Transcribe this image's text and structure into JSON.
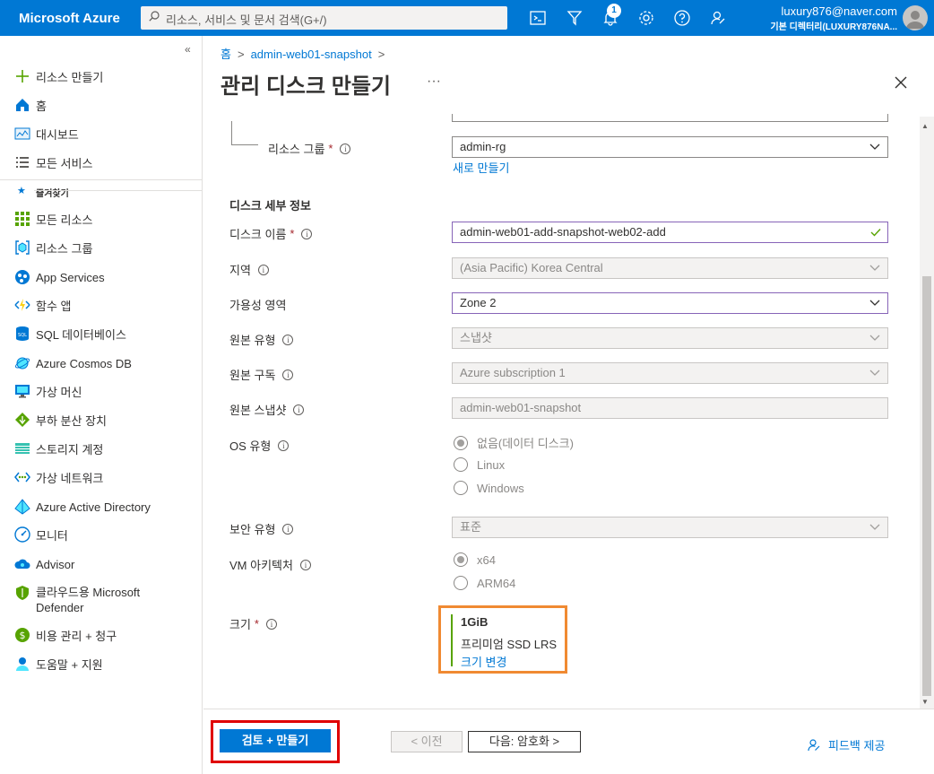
{
  "topbar": {
    "brand": "Microsoft Azure",
    "search_placeholder": "리소스, 서비스 및 문서 검색(G+/)",
    "notification_count": "1",
    "account_email": "luxury876@naver.com",
    "account_directory": "기본 디렉터리(LUXURY876NA..."
  },
  "sidebar": {
    "collapse": "«",
    "favorites_label": "즐겨찾기",
    "items": [
      {
        "label": "리소스 만들기",
        "icon": "plus-icon"
      },
      {
        "label": "홈",
        "icon": "home-icon"
      },
      {
        "label": "대시보드",
        "icon": "dashboard-icon"
      },
      {
        "label": "모든 서비스",
        "icon": "list-icon"
      },
      {
        "label": "모든 리소스",
        "icon": "grid-icon"
      },
      {
        "label": "리소스 그룹",
        "icon": "resource-group-icon"
      },
      {
        "label": "App Services",
        "icon": "app-services-icon"
      },
      {
        "label": "함수 앱",
        "icon": "function-app-icon"
      },
      {
        "label": "SQL 데이터베이스",
        "icon": "sql-icon"
      },
      {
        "label": "Azure Cosmos DB",
        "icon": "cosmos-icon"
      },
      {
        "label": "가상 머신",
        "icon": "vm-icon"
      },
      {
        "label": "부하 분산 장치",
        "icon": "load-balancer-icon"
      },
      {
        "label": "스토리지 계정",
        "icon": "storage-icon"
      },
      {
        "label": "가상 네트워크",
        "icon": "vnet-icon"
      },
      {
        "label": "Azure Active Directory",
        "icon": "aad-icon"
      },
      {
        "label": "모니터",
        "icon": "monitor-icon"
      },
      {
        "label": "Advisor",
        "icon": "advisor-icon"
      },
      {
        "label": "클라우드용 Microsoft",
        "label2": "Defender",
        "icon": "defender-icon"
      },
      {
        "label": "비용 관리 + 청구",
        "icon": "cost-icon"
      },
      {
        "label": "도움말 + 지원",
        "icon": "help-support-icon"
      }
    ]
  },
  "breadcrumb": {
    "home": "홈",
    "current": "admin-web01-snapshot",
    "sep": ">"
  },
  "page": {
    "title": "관리 디스크 만들기",
    "more": "···"
  },
  "form": {
    "resource_group": {
      "label": "리소스 그룹",
      "value": "admin-rg",
      "create_new": "새로 만들기"
    },
    "section_title": "디스크 세부 정보",
    "disk_name": {
      "label": "디스크 이름",
      "value": "admin-web01-add-snapshot-web02-add"
    },
    "region": {
      "label": "지역",
      "value": "(Asia Pacific) Korea Central"
    },
    "availability_zone": {
      "label": "가용성 영역",
      "value": "Zone 2"
    },
    "source_type": {
      "label": "원본 유형",
      "value": "스냅샷"
    },
    "source_subscription": {
      "label": "원본 구독",
      "value": "Azure subscription 1"
    },
    "source_snapshot": {
      "label": "원본 스냅샷",
      "value": "admin-web01-snapshot"
    },
    "os_type": {
      "label": "OS 유형",
      "options": [
        "없음(데이터 디스크)",
        "Linux",
        "Windows"
      ],
      "selected": 0
    },
    "security_type": {
      "label": "보안 유형",
      "value": "표준"
    },
    "vm_architecture": {
      "label": "VM 아키텍처",
      "options": [
        "x64",
        "ARM64"
      ],
      "selected": 0
    },
    "size": {
      "label": "크기",
      "value": "1GiB",
      "sku": "프리미엄 SSD LRS",
      "change": "크기 변경"
    },
    "required_mark": "*",
    "info_mark": "i"
  },
  "footer": {
    "review_create": "검토 + 만들기",
    "previous": "< 이전",
    "next": "다음: 암호화 >",
    "feedback": "피드백 제공"
  },
  "colors": {
    "azure_blue": "#0078d4",
    "highlight_orange": "#f08a32",
    "highlight_red": "#e00000"
  }
}
